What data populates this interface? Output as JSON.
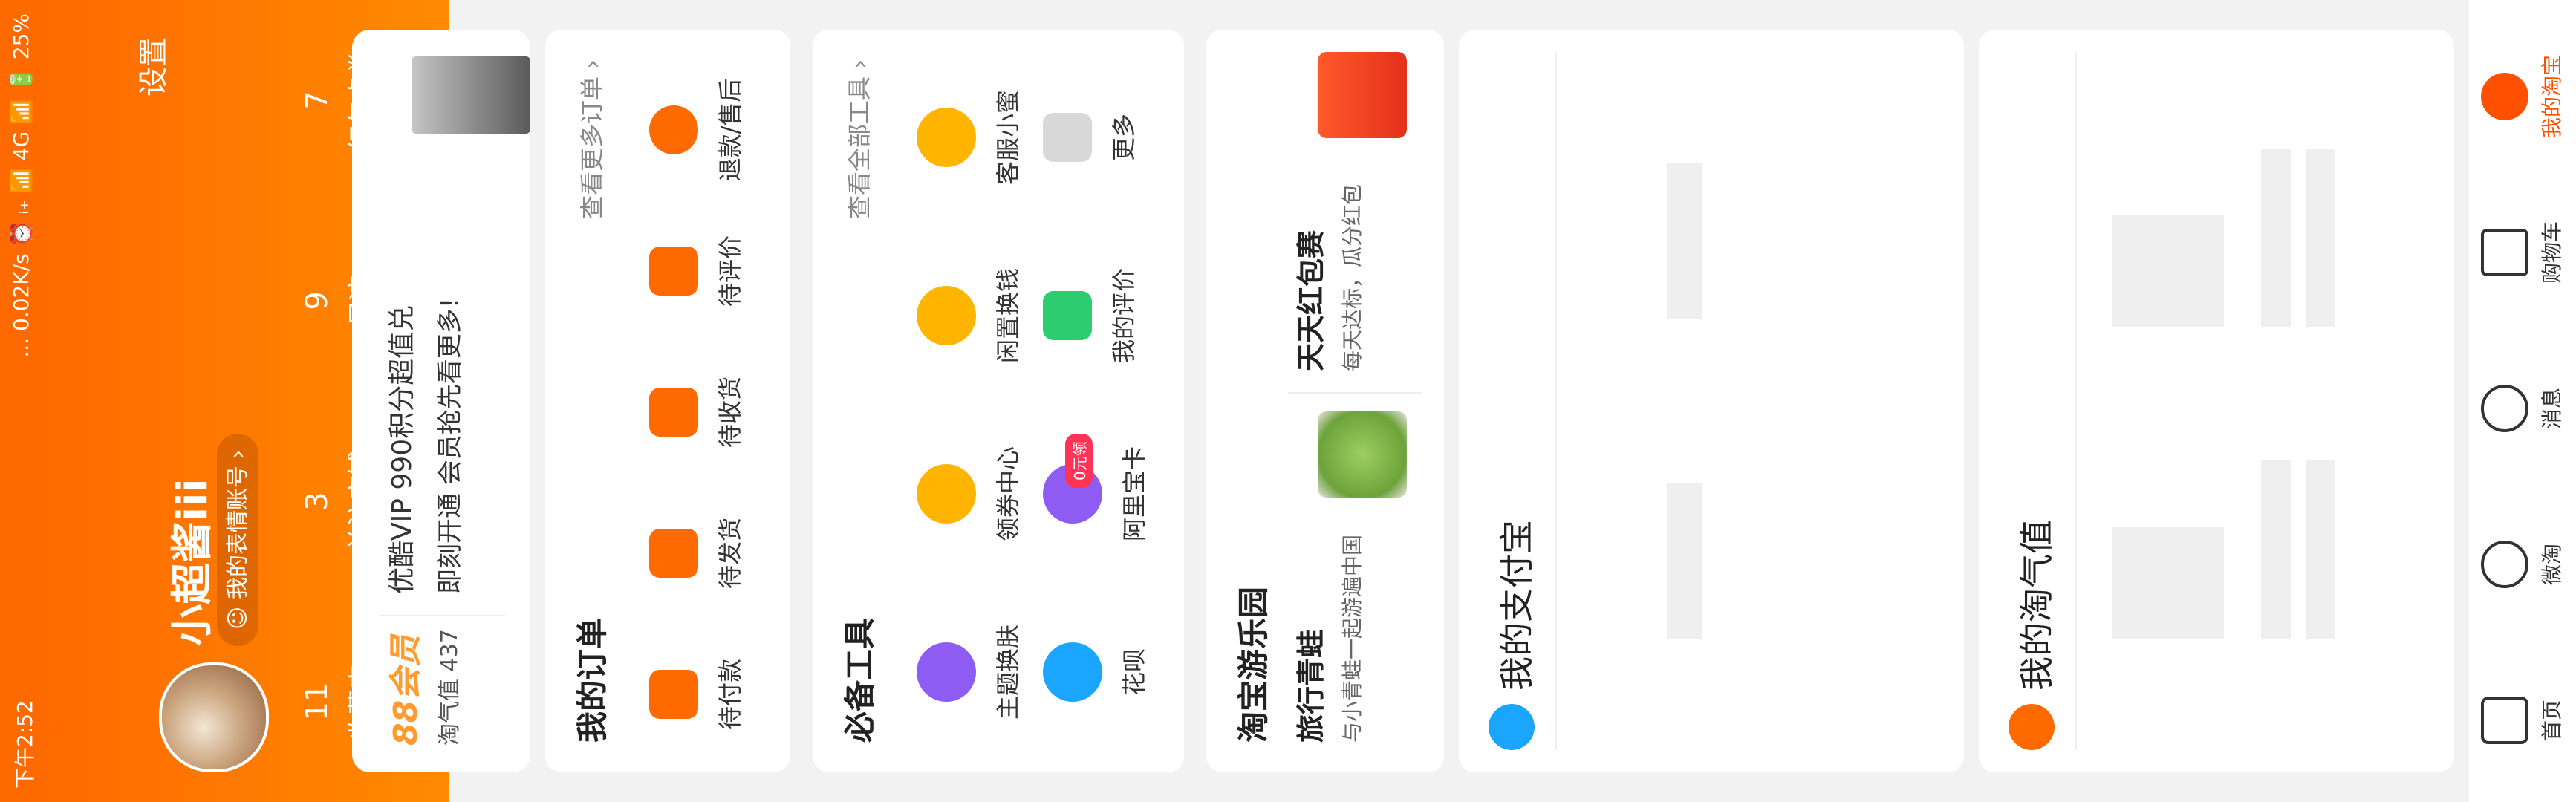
{
  "status_bar": {
    "time": "下午2:52",
    "right": "... 0.02K/s ⏰ ᵢ₊ 📶 4G 📶 🔋 25%"
  },
  "header": {
    "settings_label": "设置",
    "username": "小超酱iii",
    "emote_account": "我的表情账号 ›",
    "stats": [
      {
        "count": "11",
        "label": "收藏夹"
      },
      {
        "count": "3",
        "label": "关注店铺"
      },
      {
        "count": "9",
        "label": "足迹"
      },
      {
        "count": "7",
        "label": "红包卡券"
      }
    ]
  },
  "vip": {
    "brand": "88会员",
    "points": "淘气值 437",
    "title": "优酷VIP 990积分超值兑",
    "subtitle": "即刻开通 会员抢先看更多!"
  },
  "orders": {
    "title": "我的订单",
    "more": "查看更多订单 ›",
    "items": [
      {
        "label": "待付款",
        "icon": "wallet-icon"
      },
      {
        "label": "待发货",
        "icon": "box-icon"
      },
      {
        "label": "待收货",
        "icon": "truck-icon"
      },
      {
        "label": "待评价",
        "icon": "comment-icon"
      },
      {
        "label": "退款/售后",
        "icon": "refund-icon"
      }
    ]
  },
  "tools": {
    "title": "必备工具",
    "more": "查看全部工具 ›",
    "items": [
      {
        "label": "主题换肤",
        "icon": "palette-icon"
      },
      {
        "label": "领券中心",
        "icon": "coupon-icon"
      },
      {
        "label": "闲置换钱",
        "icon": "yen-icon"
      },
      {
        "label": "客服小蜜",
        "icon": "support-icon"
      },
      {
        "label": "花呗",
        "icon": "huabei-icon"
      },
      {
        "label": "阿里宝卡",
        "icon": "simcard-icon",
        "badge": "0元领"
      },
      {
        "label": "我的评价",
        "icon": "review-icon"
      },
      {
        "label": "更多",
        "icon": "grid-icon"
      }
    ]
  },
  "park": {
    "title": "淘宝游乐园",
    "items": [
      {
        "title": "旅行青蛙",
        "subtitle": "与小青蛙一起游遍中国"
      },
      {
        "title": "天天红包赛",
        "subtitle": "每天达标，瓜分红包"
      }
    ]
  },
  "alipay": {
    "title": "我的支付宝"
  },
  "taoqi": {
    "title": "我的淘气值"
  },
  "tabbar": {
    "items": [
      {
        "label": "首页",
        "icon": "home-icon"
      },
      {
        "label": "微淘",
        "icon": "weitao-icon"
      },
      {
        "label": "消息",
        "icon": "message-icon"
      },
      {
        "label": "购物车",
        "icon": "cart-icon"
      },
      {
        "label": "我的淘宝",
        "icon": "profile-icon"
      }
    ]
  },
  "colors": {
    "accent": "#ff6a00",
    "accent_light": "#ff8a00",
    "tab_active": "#ff5000"
  }
}
